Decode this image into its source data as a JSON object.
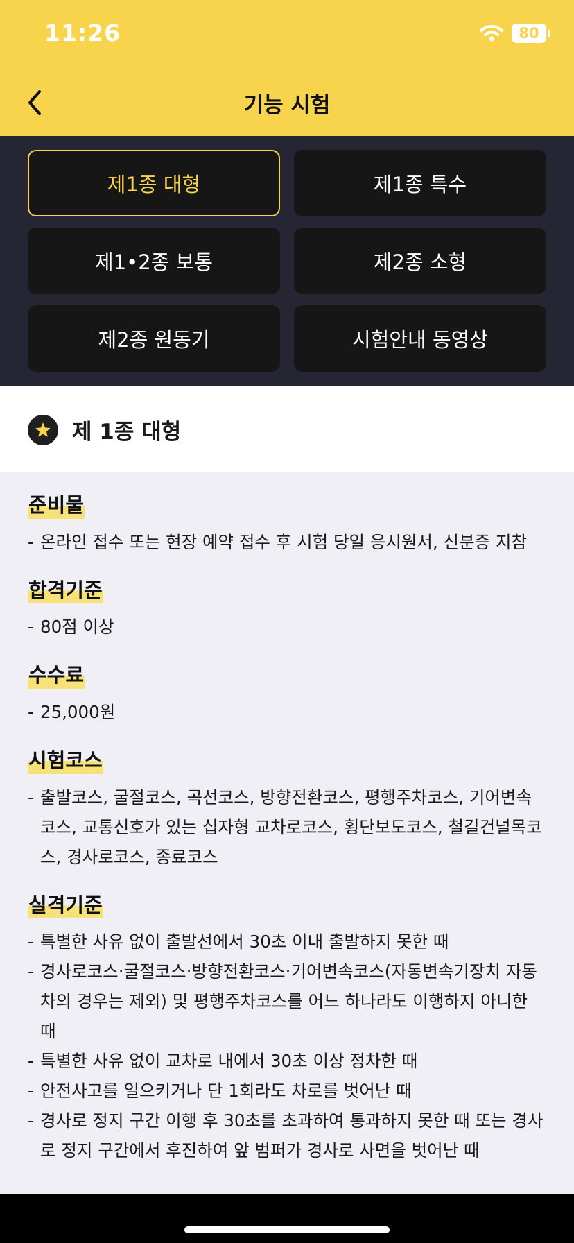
{
  "status_bar": {
    "time": "11:26",
    "battery": "80"
  },
  "navbar": {
    "title": "기능 시험"
  },
  "tabs": [
    {
      "label": "제1종 대형",
      "active": true
    },
    {
      "label": "제1종 특수",
      "active": false
    },
    {
      "label": "제1•2종 보통",
      "active": false
    },
    {
      "label": "제2종 소형",
      "active": false
    },
    {
      "label": "제2종 원동기",
      "active": false
    },
    {
      "label": "시험안내 동영상",
      "active": false
    }
  ],
  "section": {
    "title": "제 1종 대형"
  },
  "content": {
    "prep": {
      "heading": "준비물",
      "lines": [
        "온라인 접수 또는 현장 예약 접수 후 시험 당일 응시원서, 신분증 지참"
      ]
    },
    "pass": {
      "heading": "합격기준",
      "lines": [
        "80점 이상"
      ]
    },
    "fee": {
      "heading": "수수료",
      "lines": [
        "25,000원"
      ]
    },
    "course": {
      "heading": "시험코스",
      "lines": [
        "출발코스, 굴절코스, 곡선코스, 방향전환코스, 평행주차코스, 기어변속코스, 교통신호가 있는 십자형 교차로코스, 횡단보도코스, 철길건널목코스, 경사로코스, 종료코스"
      ]
    },
    "fail": {
      "heading": "실격기준",
      "lines": [
        "특별한 사유 없이 출발선에서 30초 이내 출발하지 못한 때",
        "경사로코스·굴절코스·방향전환코스·기어변속코스(자동변속기장치 자동차의 경우는 제외) 및 평행주차코스를 어느 하나라도 이행하지 아니한 때",
        "특별한 사유 없이 교차로 내에서 30초 이상 정차한 때",
        "안전사고를 일으키거나 단 1회라도 차로를 벗어난 때",
        "경사로 정지 구간 이행 후 30초를 초과하여 통과하지 못한 때 또는 경사로 정지 구간에서 후진하여 앞 범퍼가 경사로 사면을 벗어난 때"
      ]
    }
  },
  "colors": {
    "accent": "#f7d44c",
    "tab_bg": "#161616",
    "tabs_area_bg": "#262533",
    "content_bg": "#efeff5"
  },
  "icons": {
    "back": "chevron-left-icon",
    "star": "star-icon",
    "wifi": "wifi-icon"
  }
}
